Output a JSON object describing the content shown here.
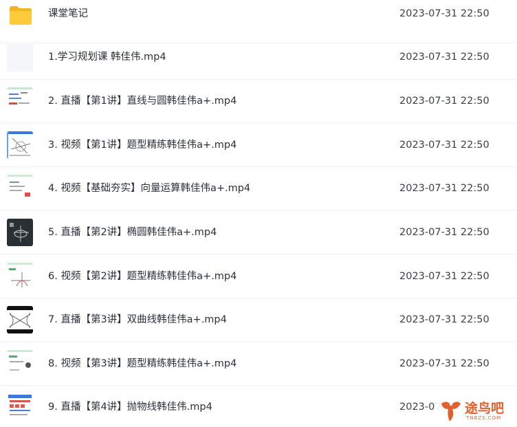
{
  "files": [
    {
      "name": "课堂笔记",
      "date": "2023-07-31 22:50",
      "icon": "folder-icon"
    },
    {
      "name": "1.学习规划课 韩佳伟.mp4",
      "date": "2023-07-31 22:50",
      "icon": "video-thumbnail-blank"
    },
    {
      "name": "2. 直播【第1讲】直线与圆韩佳伟a+.mp4",
      "date": "2023-07-31 22:50",
      "icon": "video-thumbnail"
    },
    {
      "name": "3. 视频【第1讲】题型精练韩佳伟a+.mp4",
      "date": "2023-07-31 22:50",
      "icon": "video-thumbnail"
    },
    {
      "name": "4. 视频【基础夯实】向量运算韩佳伟a+.mp4",
      "date": "2023-07-31 22:50",
      "icon": "video-thumbnail"
    },
    {
      "name": "5. 直播【第2讲】椭圆韩佳伟a+.mp4",
      "date": "2023-07-31 22:50",
      "icon": "video-thumbnail-dark"
    },
    {
      "name": "6. 视频【第2讲】题型精练韩佳伟a+.mp4",
      "date": "2023-07-31 22:50",
      "icon": "video-thumbnail"
    },
    {
      "name": "7. 直播【第3讲】双曲线韩佳伟a+.mp4",
      "date": "2023-07-31 22:50",
      "icon": "video-thumbnail"
    },
    {
      "name": "8. 视频【第3讲】题型精练韩佳伟a+.mp4",
      "date": "2023-07-31 22:50",
      "icon": "video-thumbnail"
    },
    {
      "name": "9. 直播【第4讲】抛物线韩佳伟.mp4",
      "date": "2023-07-",
      "icon": "video-thumbnail"
    }
  ],
  "watermark": {
    "text": "途鸟吧",
    "sub": "TNBZS.COM"
  },
  "colors": {
    "folder": "#f9c531",
    "accent": "#e0622e",
    "text": "#2a2f3a"
  }
}
